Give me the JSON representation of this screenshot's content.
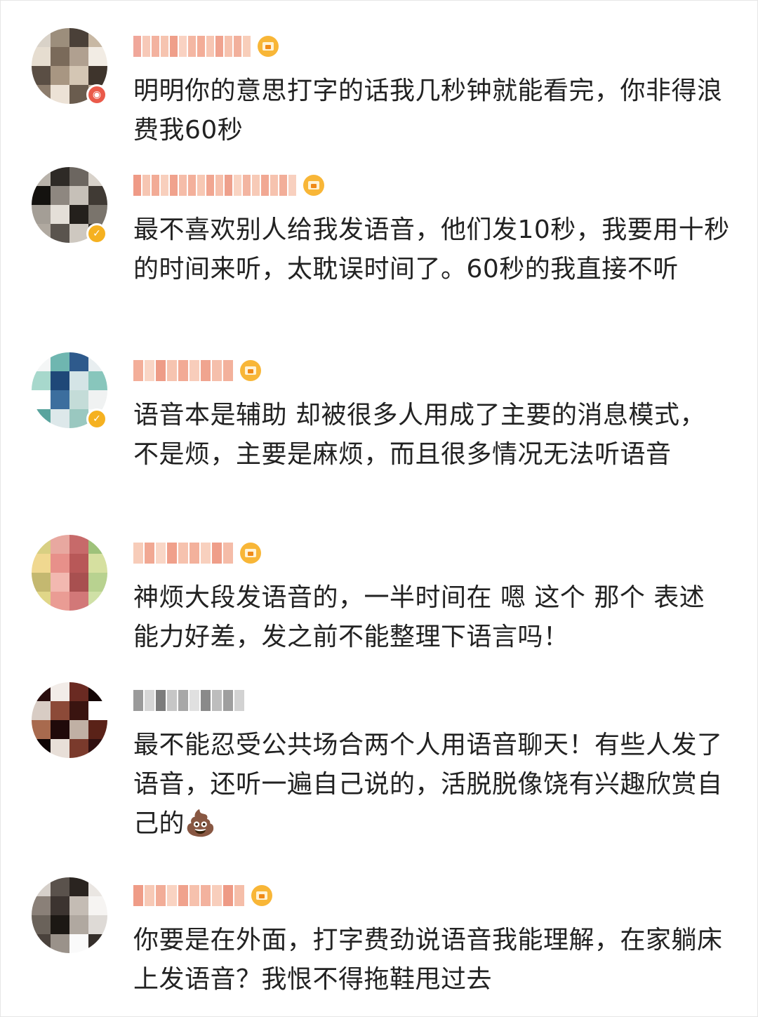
{
  "comments": [
    {
      "text": "明明你的意思打字的话我几秒钟就能看完，你非得浪费我60秒",
      "badge": "red",
      "name_colors": [
        "#f0a79a",
        "#f7c9b8",
        "#f3b29f",
        "#f6c4b0",
        "#ef9f8a",
        "#f9d2c2",
        "#f4b7a3",
        "#f3ad98",
        "#f7c6b3",
        "#f0a38f",
        "#f6c2ae",
        "#f2b09c",
        "#f8ceba"
      ],
      "has_crown": true
    },
    {
      "text": "最不喜欢别人给我发语音，他们发10秒，我要用十秒的时间来听，太耽误时间了。60秒的我直接不听",
      "badge": "gold",
      "name_colors": [
        "#ef9a86",
        "#f6c6b3",
        "#f2ab96",
        "#f8cfbd",
        "#f0a28d",
        "#f5bda9",
        "#f3b09b",
        "#f7c8b4",
        "#f1a691",
        "#f6c0ac",
        "#eea08c",
        "#f9d4c3",
        "#f3b5a1",
        "#f7cab7",
        "#f1a893",
        "#f6c3af",
        "#f2ae99",
        "#f8d0bf"
      ],
      "has_crown": true
    },
    {
      "text": "语音本是辅助 却被很多人用成了主要的消息模式，不是烦，主要是麻烦，而且很多情况无法听语音",
      "badge": "gold",
      "name_colors": [
        "#f3ae99",
        "#f9d5c5",
        "#ee9c87",
        "#f6c4b0",
        "#f2aa95",
        "#f8cdbb",
        "#f0a48f",
        "#f5bfab",
        "#f3b19c"
      ],
      "has_crown": true
    },
    {
      "text": "神烦大段发语音的，一半时间在 嗯 这个 那个 表述能力好差，发之前不能整理下语言吗！",
      "badge": "none",
      "name_colors": [
        "#f7ccb9",
        "#f1a893",
        "#f9d6c6",
        "#f0a08b",
        "#f6c2ae",
        "#f3b19c",
        "#f8d0be",
        "#ef9e89",
        "#f5bca8"
      ],
      "has_crown": true
    },
    {
      "text": "最不能忍受公共场合两个人用语音聊天！有些人发了语音，还听一遍自己说的，活脱脱像饶有兴趣欣赏自己的💩",
      "badge": "none",
      "name_colors": [
        "#9a9a9a",
        "#d6d6d6",
        "#7c7c7c",
        "#c6c6c6",
        "#a8a8a8",
        "#e0e0e0",
        "#8a8a8a",
        "#bdbdbd",
        "#9f9f9f",
        "#d2d2d2"
      ],
      "has_crown": false
    },
    {
      "text": "你要是在外面，打字费劲说语音我能理解，在家躺床上发语音？我恨不得拖鞋甩过去",
      "badge": "none",
      "name_colors": [
        "#ef9c87",
        "#f7c9b6",
        "#f2ad98",
        "#f9d3c2",
        "#f0a28d",
        "#f6c1ad",
        "#f3b29e",
        "#f8cebc",
        "#ee9a85",
        "#f5bea9"
      ],
      "has_crown": true
    }
  ],
  "avatars": [
    {
      "colors": [
        "#d9d2c8",
        "#9c8e7c",
        "#4a4038",
        "#c8b8a4",
        "#e6ddd0",
        "#7a6a5a",
        "#b0a090",
        "#f2ece4",
        "#5a4e44",
        "#a89682",
        "#d4c6b4",
        "#3e342c",
        "#8c7c6c",
        "#ece2d6",
        "#6a5c4e",
        "#beae9c"
      ]
    },
    {
      "colors": [
        "#b8b2aa",
        "#2e2a26",
        "#6c6660",
        "#d8d2ca",
        "#14120f",
        "#8e8780",
        "#c6c0b8",
        "#403a34",
        "#a49e96",
        "#e4dfd8",
        "#24201c",
        "#7a746c",
        "#b0a9a0",
        "#5a544e",
        "#ceC8c0",
        "#322e2a"
      ]
    },
    {
      "colors": [
        "#f4f6f6",
        "#6fb6b0",
        "#2e5a8c",
        "#e8eef0",
        "#a7d8cc",
        "#1f4878",
        "#d4e4e6",
        "#88c6bc",
        "#ffffff",
        "#3c6e9e",
        "#c4dcd8",
        "#f0f2f2",
        "#5aa49e",
        "#dde8ea",
        "#9ac8c0",
        "#f8fafa"
      ]
    },
    {
      "colors": [
        "#d8cf82",
        "#e8a8a0",
        "#c76a6a",
        "#9ec27a",
        "#f0d890",
        "#e7908a",
        "#b85858",
        "#d6e0a0",
        "#c4b870",
        "#f2b8b0",
        "#a85050",
        "#b8d290",
        "#e0d688",
        "#ea9c94",
        "#d27878",
        "#cfe0a6"
      ]
    },
    {
      "colors": [
        "#2a0e0e",
        "#f2ece8",
        "#6a2a22",
        "#140606",
        "#d8ccc4",
        "#8c4a38",
        "#3a1410",
        "#ffffff",
        "#a86a4e",
        "#200a0a",
        "#c0b0a4",
        "#5a2218",
        "#0e0404",
        "#e8dfd8",
        "#7a3a2c",
        "#301010"
      ]
    },
    {
      "colors": [
        "#d6d0ca",
        "#5a524c",
        "#2a2420",
        "#eae6e2",
        "#8a8078",
        "#3c3430",
        "#c4bcb4",
        "#f6f4f2",
        "#6a625a",
        "#1c1814",
        "#b0a8a0",
        "#dedad6",
        "#4a423c",
        "#9a928a",
        "#fafafa",
        "#342e2a"
      ]
    }
  ],
  "colors": {
    "text": "#222222",
    "badge_red": "#ea5a4a",
    "badge_gold": "#f5b120",
    "crown": "#f8b637",
    "frame_border": "#e6e6e6"
  }
}
